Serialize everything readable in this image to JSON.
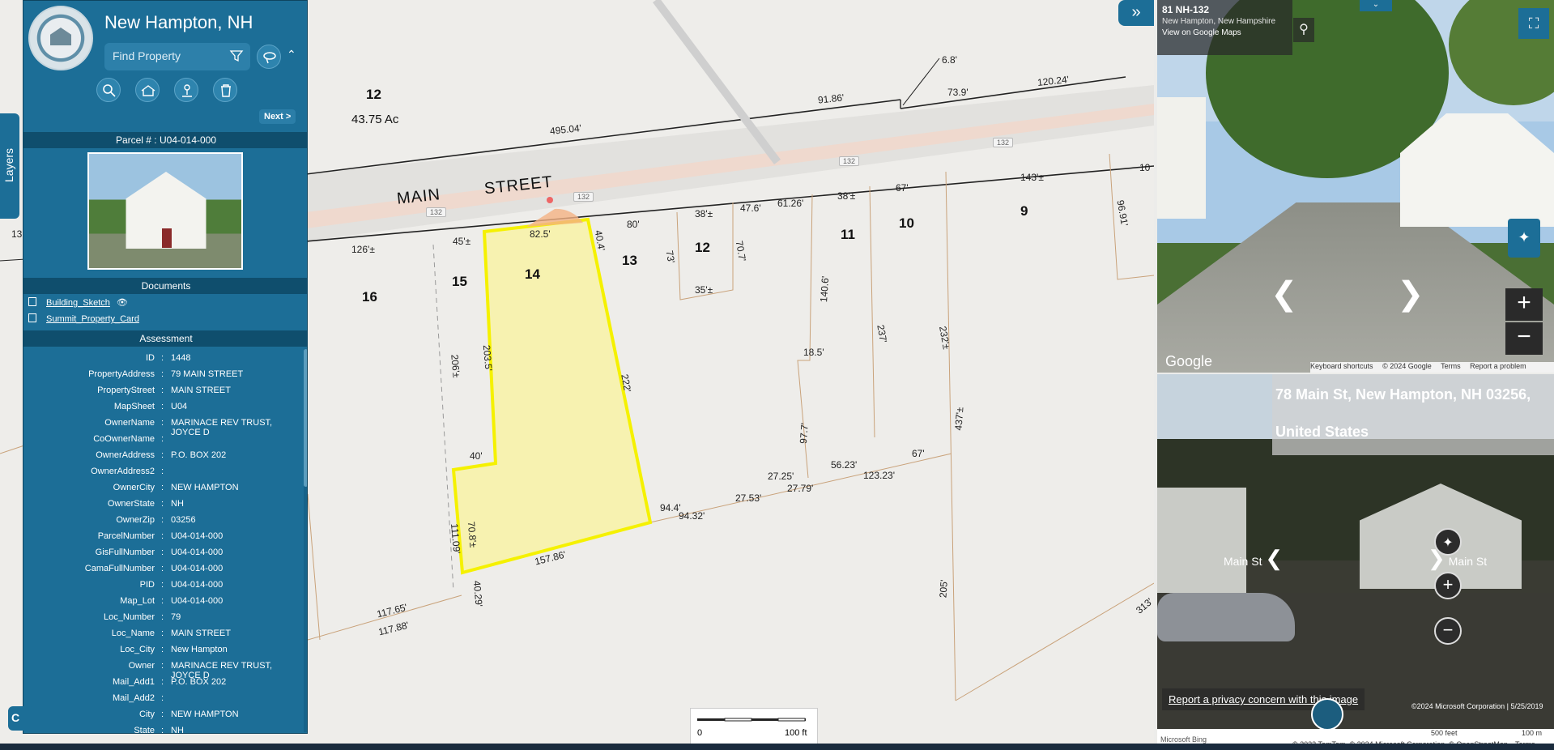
{
  "app": {
    "town": "New Hampton, NH",
    "search_placeholder": "Find Property",
    "next_label": "Next >",
    "layers_label": "Layers",
    "corner_badge": "C"
  },
  "toolbar": {
    "icons": [
      "search-icon",
      "property-icon",
      "location-icon",
      "trash-icon"
    ]
  },
  "parcel": {
    "header": "Parcel # : U04-014-000",
    "documents_header": "Documents",
    "documents": [
      "Building_Sketch",
      "Summit_Property_Card"
    ],
    "assessment_header": "Assessment",
    "fields": [
      {
        "k": "ID",
        "v": "1448"
      },
      {
        "k": "PropertyAddress",
        "v": "79 MAIN STREET"
      },
      {
        "k": "PropertyStreet",
        "v": "MAIN STREET"
      },
      {
        "k": "MapSheet",
        "v": "U04"
      },
      {
        "k": "OwnerName",
        "v": "MARINACE REV TRUST, JOYCE D"
      },
      {
        "k": "CoOwnerName",
        "v": ""
      },
      {
        "k": "OwnerAddress",
        "v": "P.O. BOX 202"
      },
      {
        "k": "OwnerAddress2",
        "v": ""
      },
      {
        "k": "OwnerCity",
        "v": "NEW HAMPTON"
      },
      {
        "k": "OwnerState",
        "v": "NH"
      },
      {
        "k": "OwnerZip",
        "v": "03256"
      },
      {
        "k": "ParcelNumber",
        "v": "U04-014-000"
      },
      {
        "k": "GisFullNumber",
        "v": "U04-014-000"
      },
      {
        "k": "CamaFullNumber",
        "v": "U04-014-000"
      },
      {
        "k": "PID",
        "v": "U04-014-000"
      },
      {
        "k": "Map_Lot",
        "v": "U04-014-000"
      },
      {
        "k": "Loc_Number",
        "v": "79"
      },
      {
        "k": "Loc_Name",
        "v": "MAIN STREET"
      },
      {
        "k": "Loc_City",
        "v": "New Hampton"
      },
      {
        "k": "Owner",
        "v": "MARINACE REV TRUST, JOYCE D"
      },
      {
        "k": "Mail_Add1",
        "v": "P.O. BOX 202"
      },
      {
        "k": "Mail_Add2",
        "v": ""
      },
      {
        "k": "City",
        "v": "NEW HAMPTON"
      },
      {
        "k": "State",
        "v": "NH"
      }
    ]
  },
  "map": {
    "street_name_1": "MAIN",
    "street_name_2": "STREET",
    "route": "132",
    "acres": "43.75 Ac",
    "parcels": [
      "12",
      "16",
      "15",
      "14",
      "13",
      "12",
      "11",
      "10",
      "9"
    ],
    "dims": [
      "495.04'",
      "91.86'",
      "73.9'",
      "120.24'",
      "6.8'",
      "126'±",
      "45'±",
      "82.5'",
      "40.4'",
      "80'",
      "38'±",
      "47.6'",
      "61.26'",
      "38'±",
      "67'",
      "143'±",
      "10",
      "96.91'",
      "73'",
      "70.7'",
      "35'±",
      "140.6'",
      "237'",
      "232'±",
      "18.5'",
      "206'±",
      "203.5'",
      "222'",
      "97.7'",
      "437'±",
      "40'",
      "67'",
      "56.23'",
      "123.23'",
      "27.25'",
      "27.79'",
      "27.53'",
      "94.4'",
      "94.32'",
      "111.09'",
      "70.8'±",
      "157.86'",
      "40.29'",
      "117.65'",
      "117.88'",
      "205'",
      "313'",
      "13"
    ],
    "scale_min": "0",
    "scale_max": "100 ft"
  },
  "streetview": {
    "title": "81 NH-132",
    "subtitle": "New Hampton, New Hampshire",
    "maps_link": "View on Google Maps",
    "logo": "Google",
    "footer": [
      "Keyboard shortcuts",
      "© 2024 Google",
      "Terms",
      "Report a problem"
    ]
  },
  "bing": {
    "address": "78 Main St, New Hampton, NH 03256, United States",
    "nav_left": "Main St",
    "nav_right": "Main St",
    "report": "Report a privacy concern with this image",
    "copyright": "©2024 Microsoft Corporation | 5/25/2019",
    "brand": "Microsoft Bing",
    "scale_ft": "500 feet",
    "scale_m": "100 m",
    "attribution": "© 2023 TomTom, © 2024 Microsoft Corporation, © OpenStreetMap",
    "terms": "Terms"
  },
  "colors": {
    "panel": "#1c6e97",
    "highlight": "#f5f100"
  }
}
